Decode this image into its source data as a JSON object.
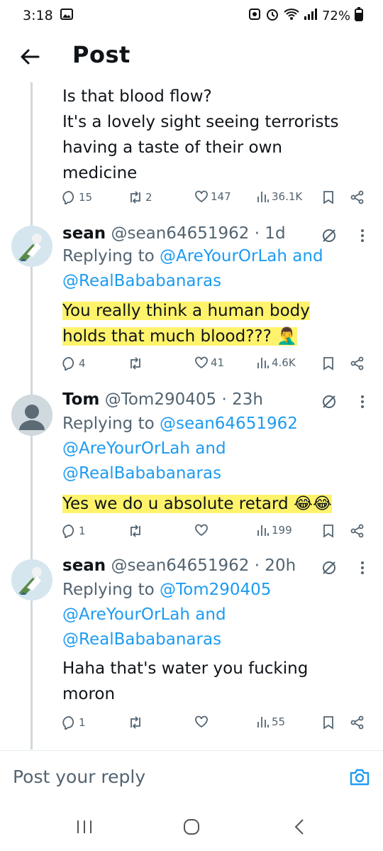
{
  "status_bar": {
    "time": "3:18",
    "battery": "72%"
  },
  "app_bar": {
    "title": "Post"
  },
  "tweets": [
    {
      "text_lines": [
        "Is that blood flow?",
        "It's a lovely sight seeing terrorists",
        "having a taste of their own",
        "medicine"
      ],
      "replies": "15",
      "reposts": "2",
      "likes": "147",
      "views": "36.1K"
    },
    {
      "name": "sean",
      "handle": "@sean64651962",
      "time": "· 1d",
      "reply_prefix": "Replying to",
      "mentions": [
        "@AreYourOrLah",
        "and",
        "@RealBababanaras"
      ],
      "text_lines": [
        "You really think a human body",
        "holds that much blood??? 🤦‍♂️"
      ],
      "replies": "4",
      "reposts": "",
      "likes": "41",
      "views": "4.6K"
    },
    {
      "name": "Tom",
      "handle": "@Tom290405",
      "time": "· 23h",
      "reply_prefix": "Replying to",
      "mentions": [
        "@sean64651962",
        "@AreYourOrLah",
        "and",
        "@RealBababanaras"
      ],
      "text_lines": [
        "Yes we do u absolute retard 😂😂"
      ],
      "replies": "1",
      "reposts": "",
      "likes": "",
      "views": "199"
    },
    {
      "name": "sean",
      "handle": "@sean64651962",
      "time": "· 20h",
      "reply_prefix": "Replying to",
      "mentions": [
        "@Tom290405",
        "@AreYourOrLah",
        "and",
        "@RealBababanaras"
      ],
      "text_lines": [
        "Haha that's water you fucking",
        "moron"
      ],
      "replies": "1",
      "reposts": "",
      "likes": "",
      "views": "55"
    }
  ],
  "composer": {
    "placeholder": "Post your reply"
  },
  "colors": {
    "accent": "#1d9bf0",
    "highlight": "#fff36b",
    "muted": "#536471"
  }
}
